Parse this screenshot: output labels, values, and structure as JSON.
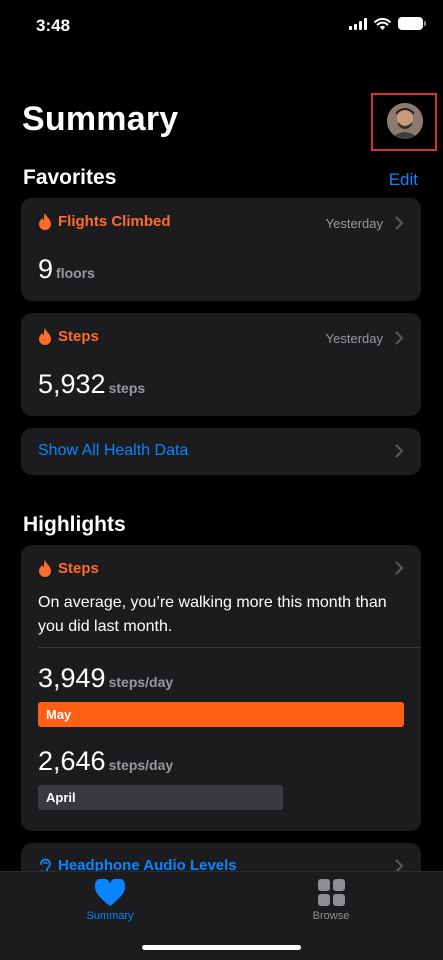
{
  "status_bar": {
    "time": "3:48"
  },
  "header": {
    "title": "Summary"
  },
  "favorites": {
    "title": "Favorites",
    "edit_label": "Edit",
    "cards": [
      {
        "title": "Flights Climbed",
        "date": "Yesterday",
        "value": "9",
        "unit": "floors"
      },
      {
        "title": "Steps",
        "date": "Yesterday",
        "value": "5,932",
        "unit": "steps"
      }
    ],
    "show_all_label": "Show All Health Data"
  },
  "highlights": {
    "title": "Highlights",
    "card": {
      "title": "Steps",
      "text": "On average, you’re walking more this month than you did last month.",
      "current": {
        "value": "3,949",
        "unit": "steps/day",
        "label": "May",
        "color": "#ff5f15"
      },
      "previous": {
        "value": "2,646",
        "unit": "steps/day",
        "label": "April",
        "color": "#3a3a3e"
      }
    },
    "next_card_title": "Headphone Audio Levels"
  },
  "tab_bar": {
    "tabs": [
      {
        "label": "Summary",
        "icon": "heart-icon",
        "active": true
      },
      {
        "label": "Browse",
        "icon": "grid-icon",
        "active": false
      }
    ]
  },
  "colors": {
    "accent": "#0a84ff",
    "orange": "#ff6a2f",
    "card_bg": "#1c1c1e"
  }
}
